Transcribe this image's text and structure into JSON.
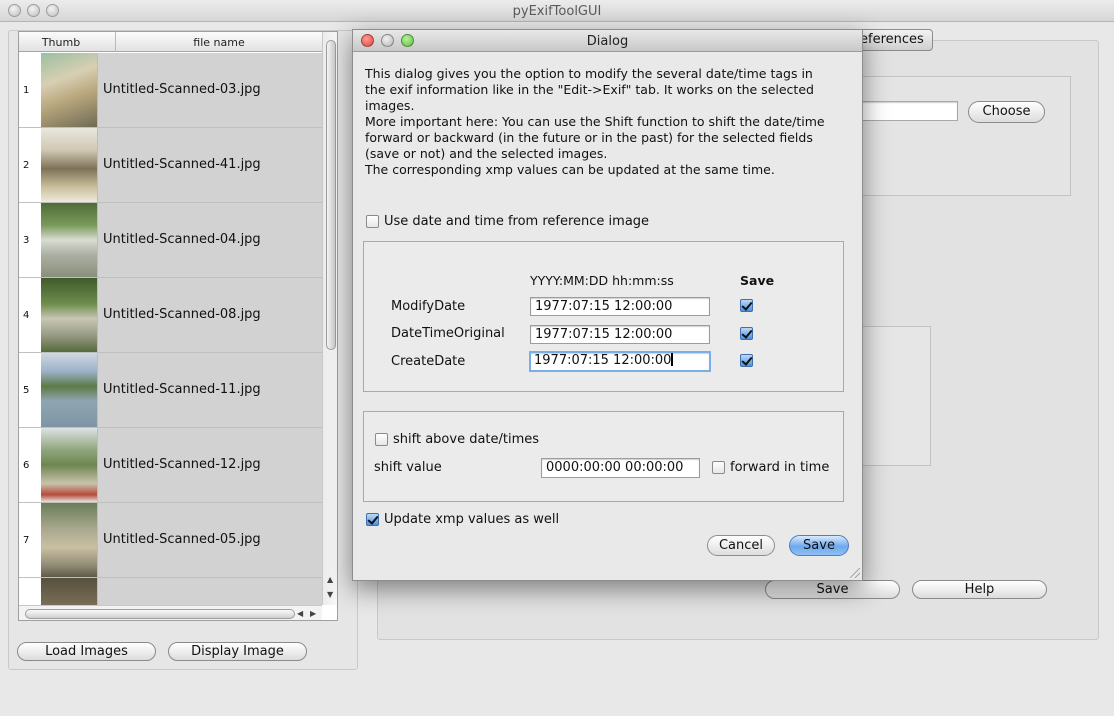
{
  "app": {
    "title": "pyExifToolGUI"
  },
  "file_table": {
    "headers": {
      "thumb": "Thumb",
      "file_name": "file name"
    },
    "rows": [
      {
        "index": "1",
        "name": "Untitled-Scanned-03.jpg"
      },
      {
        "index": "2",
        "name": "Untitled-Scanned-41.jpg"
      },
      {
        "index": "3",
        "name": "Untitled-Scanned-04.jpg"
      },
      {
        "index": "4",
        "name": "Untitled-Scanned-08.jpg"
      },
      {
        "index": "5",
        "name": "Untitled-Scanned-11.jpg"
      },
      {
        "index": "6",
        "name": "Untitled-Scanned-12.jpg"
      },
      {
        "index": "7",
        "name": "Untitled-Scanned-05.jpg"
      }
    ]
  },
  "left_buttons": {
    "load_images": "Load Images",
    "display_image": "Display Image"
  },
  "background": {
    "tab_partial": "eferences",
    "choose_button": "Choose",
    "save_button": "Save",
    "help_button": "Help"
  },
  "dialog": {
    "title": "Dialog",
    "info_lines": [
      "This dialog gives you the option to modify the several date/time tags in",
      "the exif information like in the \"Edit->Exif\" tab. It works on the selected",
      "images.",
      "More important here: You can use the Shift function to shift the date/time",
      "forward or backward (in the future or in the past) for the selected fields",
      "(save or not) and the selected images.",
      "The corresponding xmp values can be updated at the same time."
    ],
    "use_reference_label": "Use date and time from reference image",
    "format_header": "YYYY:MM:DD hh:mm:ss",
    "save_header": "Save",
    "dates": [
      {
        "label": "ModifyDate",
        "value": "1977:07:15 12:00:00"
      },
      {
        "label": "DateTimeOriginal",
        "value": "1977:07:15 12:00:00"
      },
      {
        "label": "CreateDate",
        "value": "1977:07:15 12:00:00"
      }
    ],
    "shift_label": "shift above date/times",
    "shift_value_label": "shift value",
    "shift_value": "0000:00:00 00:00:00",
    "forward_label": "forward in time",
    "update_xmp_label": "Update xmp values as well",
    "cancel_label": "Cancel",
    "save_label": "Save"
  },
  "colors": {
    "selection_gray": "#d2d2d2",
    "primary_button": "#6ea9ec",
    "close_red": "#e0443b",
    "minimize_gray": "#b5b5b5",
    "zoom_green": "#59c13c"
  }
}
